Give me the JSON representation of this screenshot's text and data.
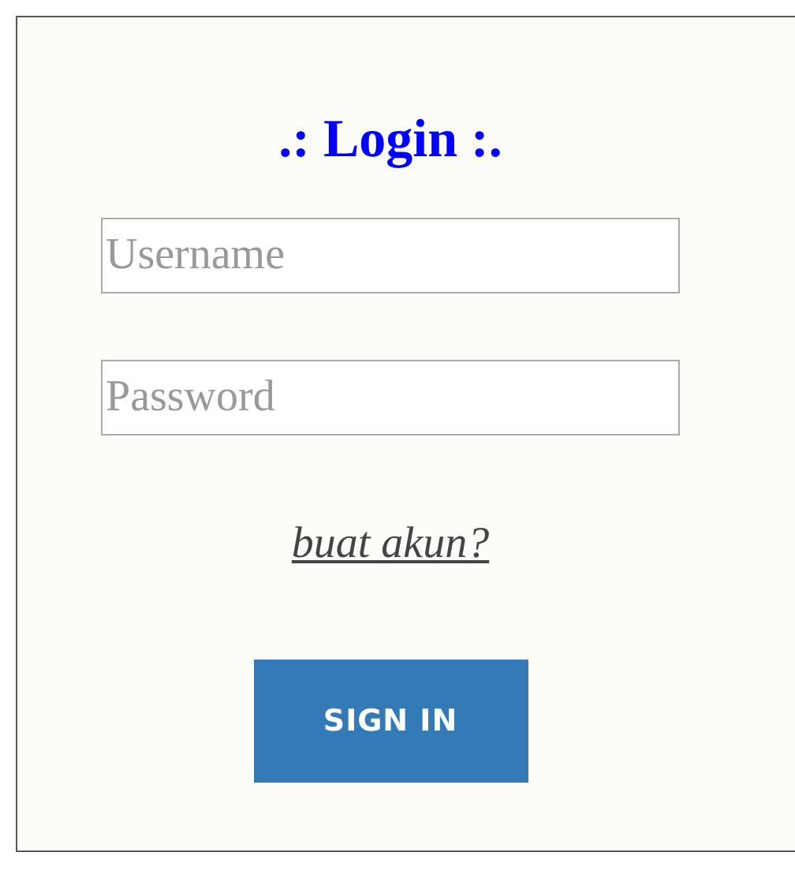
{
  "title": ".: Login :.",
  "fields": [
    {
      "placeholder": "Username"
    },
    {
      "placeholder": "Password"
    }
  ],
  "link": "buat akun?",
  "button": "SIGN IN"
}
